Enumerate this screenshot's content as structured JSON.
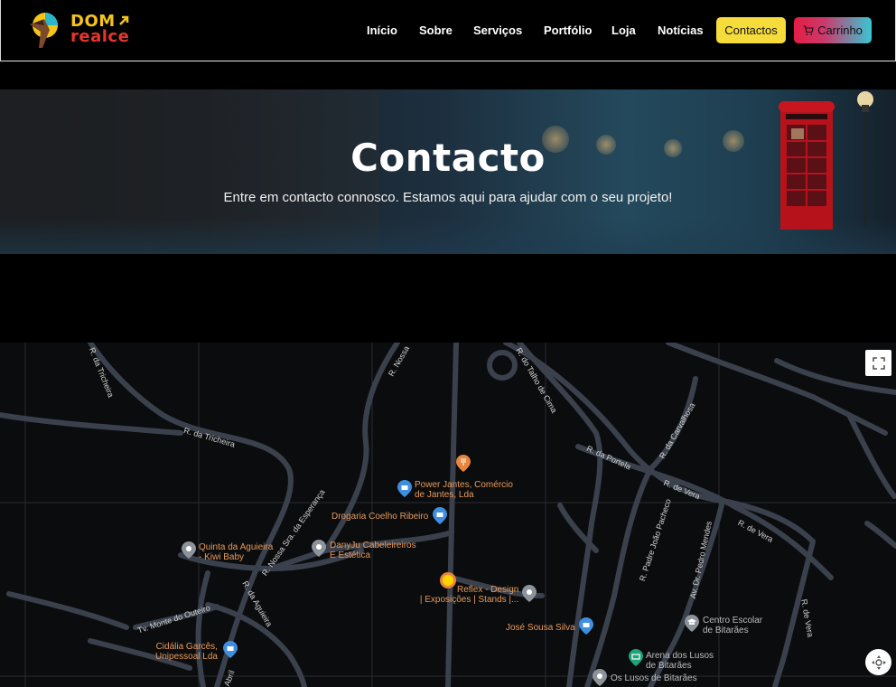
{
  "header": {
    "logo": {
      "line1": "DOM",
      "line2": "realce"
    },
    "nav": [
      {
        "label": "Início"
      },
      {
        "label": "Sobre"
      },
      {
        "label": "Serviços"
      },
      {
        "label": "Portfólio"
      },
      {
        "label": "Loja"
      },
      {
        "label": "Notícias"
      }
    ],
    "contact_button": "Contactos",
    "cart_button": "Carrinho",
    "colors": {
      "contact_bg": "#f6dc3b",
      "cart_gradient_start": "#e51d45",
      "cart_gradient_end": "#38c7d4"
    }
  },
  "hero": {
    "title": "Contacto",
    "subtitle": "Entre em contacto connosco. Estamos aqui para ajudar com o seu projeto!"
  },
  "map": {
    "streets": [
      "R. da Tricheira",
      "R. da Tricheira",
      "R. Nossa",
      "R. do Talho de Cima",
      "R. da Carvalhosa",
      "R. da Portela",
      "R. de Vera",
      "R. de Vera",
      "R. Nossa Sra. da Esperança",
      "R. da Aguieira",
      "R. Padre João Pacheco",
      "Av. Dr. Pedro Mendes",
      "Tv. Monte do Outeiro",
      "R. de Vera",
      "Abril"
    ],
    "pois": [
      {
        "line1": "Power Jantes, Comércio",
        "line2": "de Jantes, Lda"
      },
      {
        "line1": "Drogaria Coelho Ribeiro",
        "line2": ""
      },
      {
        "line1": "Quinta da Aguieira",
        "line2": "- Kiwi Baby"
      },
      {
        "line1": "DanyJu Cabeleireiros",
        "line2": "E Estética"
      },
      {
        "line1": "Reflex - Design",
        "line2": "| Exposições | Stands |..."
      },
      {
        "line1": "José Sousa Silva",
        "line2": ""
      },
      {
        "line1": "Centro Escolar",
        "line2": "de Bitarães"
      },
      {
        "line1": "Cidália Garcês,",
        "line2": "Unipessoal Lda"
      },
      {
        "line1": "Arena dos Lusos",
        "line2": "de Bitarães"
      },
      {
        "line1": "Os Lusos de Bitarães",
        "line2": ""
      }
    ],
    "icons": [
      "fullscreen-icon",
      "my-location-icon",
      "restaurant-pin-icon",
      "shop-pin-icon",
      "place-pin-icon",
      "school-pin-icon",
      "stadium-pin-icon",
      "fuel-pin-icon"
    ]
  }
}
